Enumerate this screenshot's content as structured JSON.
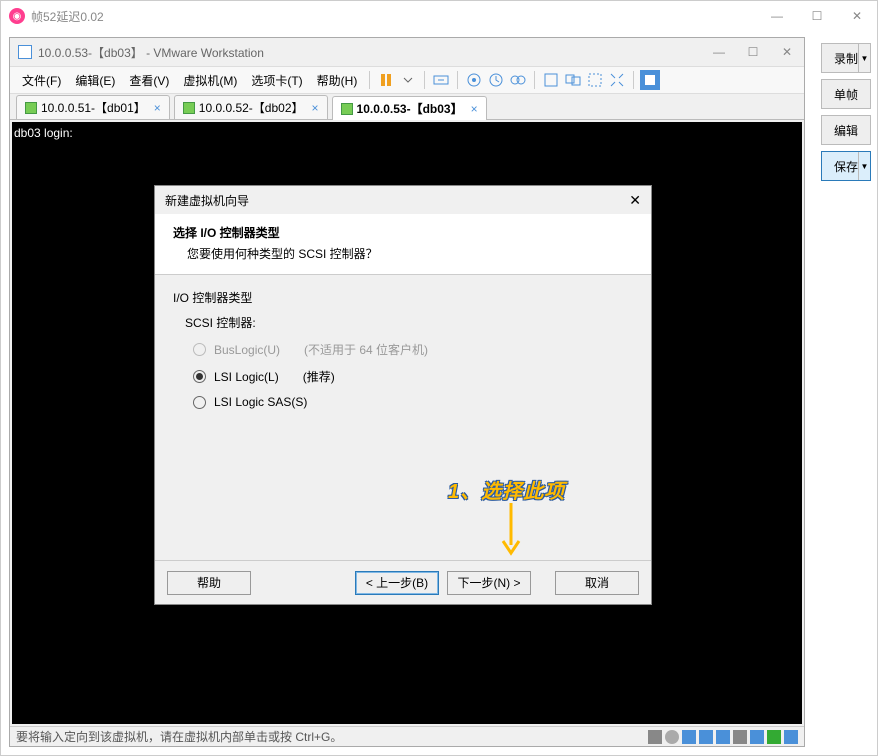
{
  "outer": {
    "title": "帧52延迟0.02",
    "min": "—",
    "max": "☐",
    "close": "✕"
  },
  "side": {
    "record": "录制",
    "single": "单帧",
    "edit": "编辑",
    "save": "保存"
  },
  "vm": {
    "title": "10.0.0.53-【db03】 - VMware Workstation",
    "min": "—",
    "max": "☐",
    "close": "✕"
  },
  "menu": {
    "file": "文件(F)",
    "edit": "编辑(E)",
    "view": "查看(V)",
    "vm": "虚拟机(M)",
    "tabs": "选项卡(T)",
    "help": "帮助(H)"
  },
  "tabs": [
    {
      "label": "10.0.0.51-【db01】"
    },
    {
      "label": "10.0.0.52-【db02】"
    },
    {
      "label": "10.0.0.53-【db03】"
    }
  ],
  "term": {
    "line1": "db03 login:"
  },
  "status": {
    "text": "要将输入定向到该虚拟机，请在虚拟机内部单击或按 Ctrl+G。"
  },
  "wizard": {
    "title": "新建虚拟机向导",
    "close": "✕",
    "heading": "选择 I/O 控制器类型",
    "subheading": "您要使用何种类型的 SCSI 控制器？",
    "group": "I/O 控制器类型",
    "sub": "SCSI 控制器:",
    "opt1": "BusLogic(U)",
    "note1": "(不适用于 64 位客户机)",
    "opt2": "LSI Logic(L)",
    "note2": "(推荐)",
    "opt3": "LSI Logic SAS(S)",
    "help": "帮助",
    "back": "< 上一步(B)",
    "next": "下一步(N) >",
    "cancel": "取消"
  },
  "annotation": {
    "text": "1、选择此项"
  }
}
